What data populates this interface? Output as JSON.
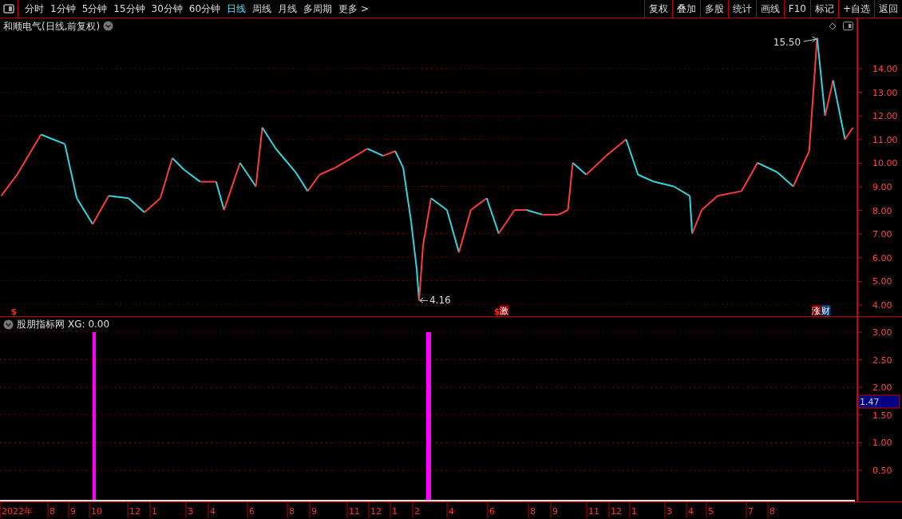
{
  "toolbar": {
    "periods": [
      {
        "label": "分时",
        "selected": false
      },
      {
        "label": "1分钟",
        "selected": false
      },
      {
        "label": "5分钟",
        "selected": false
      },
      {
        "label": "15分钟",
        "selected": false
      },
      {
        "label": "30分钟",
        "selected": false
      },
      {
        "label": "60分钟",
        "selected": false
      },
      {
        "label": "日线",
        "selected": true
      },
      {
        "label": "周线",
        "selected": false
      },
      {
        "label": "月线",
        "selected": false
      },
      {
        "label": "多周期",
        "selected": false
      },
      {
        "label": "更多 >",
        "selected": false
      }
    ],
    "buttons": [
      "复权",
      "叠加",
      "多股",
      "统计",
      "画线",
      "F10",
      "标记",
      "+自选",
      "返回"
    ]
  },
  "price_panel": {
    "title": "和顺电气(日线,前复权)",
    "high_label": "15.50",
    "low_label": "4.16",
    "yticks": [
      "14.00",
      "13.00",
      "12.00",
      "11.00",
      "10.00",
      "9.00",
      "8.00",
      "7.00",
      "6.00",
      "5.00",
      "4.00"
    ],
    "markers": [
      {
        "text": "$",
        "kind": "plain"
      },
      {
        "text": "$",
        "kind": "plain"
      },
      {
        "text": "激",
        "kind": "badge"
      },
      {
        "text": "涨",
        "kind": "badge"
      },
      {
        "text": "财",
        "kind": "badge"
      }
    ]
  },
  "indicator_panel": {
    "title": "股朋指标网",
    "reading": "XG: 0.00",
    "yticks": [
      "3.00",
      "2.50",
      "2.00",
      "1.50",
      "1.00",
      "0.50"
    ],
    "cursor_value": "1.47"
  },
  "date_axis": [
    "2022年",
    "8",
    "9",
    "10",
    "12",
    "1",
    "3",
    "4",
    "6",
    "8",
    "9",
    "11",
    "12",
    "1",
    "2",
    "4",
    "6",
    "8",
    "9",
    "11",
    "12",
    "1",
    "3",
    "4",
    "5",
    "7",
    "8"
  ]
}
